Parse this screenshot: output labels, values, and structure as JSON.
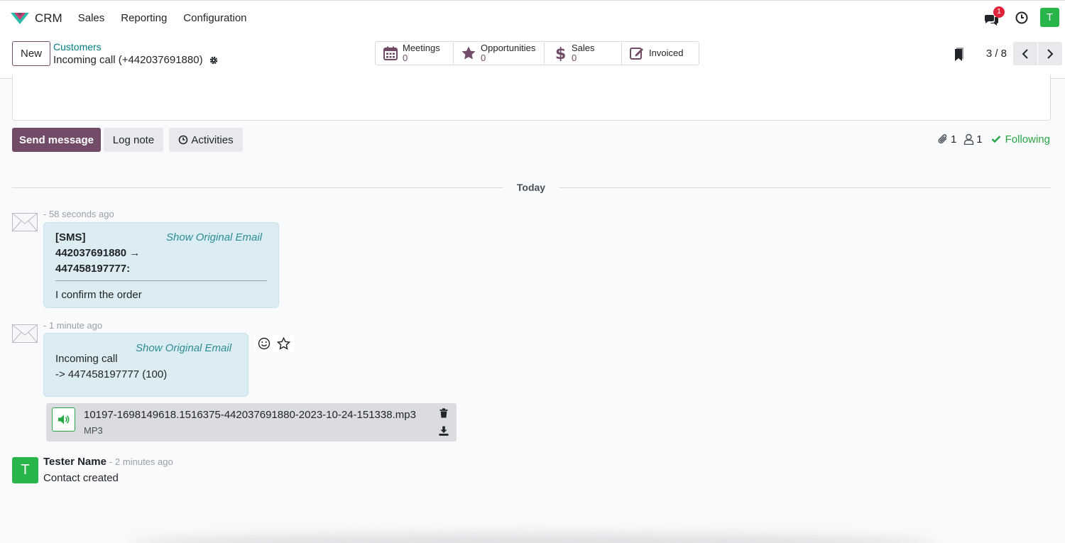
{
  "navbar": {
    "app_name": "CRM",
    "menu": [
      "Sales",
      "Reporting",
      "Configuration"
    ],
    "message_count": "1",
    "user_initial": "T",
    "icons": {
      "logo": "crm-logo-icon",
      "messages": "chat-bubbles-icon",
      "activities": "clock-icon"
    }
  },
  "control_panel": {
    "new_label": "New",
    "breadcrumb_parent": "Customers",
    "breadcrumb_current": "Incoming call (+442037691880)",
    "smart_buttons": [
      {
        "label": "Meetings",
        "value": "0",
        "icon": "calendar-icon"
      },
      {
        "label": "Opportunities",
        "value": "0",
        "icon": "star-icon"
      },
      {
        "label": "Sales",
        "value": "0",
        "icon": "dollar-icon"
      },
      {
        "label": "Invoiced",
        "value": "",
        "icon": "edit-icon"
      }
    ],
    "pager": "3 / 8"
  },
  "chatter": {
    "send_message": "Send message",
    "log_note": "Log note",
    "activities": "Activities",
    "attachment_count": "1",
    "follower_count": "1",
    "following": "Following",
    "separator": "Today",
    "messages": [
      {
        "date": "- 58 seconds ago",
        "show_original": "Show Original Email",
        "header_lines": [
          "[SMS]",
          "442037691880 →",
          "447458197777:"
        ],
        "body": "I confirm the order"
      },
      {
        "date": "- 1 minute ago",
        "show_original": "Show Original Email",
        "body_lines": [
          "Incoming call",
          "-> 447458197777 (100)"
        ],
        "attachment": {
          "name": "10197-1698149618.1516375-442037691880-2023-10-24-151338.mp3",
          "type": "MP3"
        }
      },
      {
        "author": "Tester Name",
        "author_initial": "T",
        "date": "- 2 minutes ago",
        "body": "Contact created"
      }
    ]
  },
  "colors": {
    "brand": "#714b67",
    "link": "#017e84",
    "following": "#28a745",
    "badge": "#e0233a",
    "bubble": "#dcecf3"
  }
}
